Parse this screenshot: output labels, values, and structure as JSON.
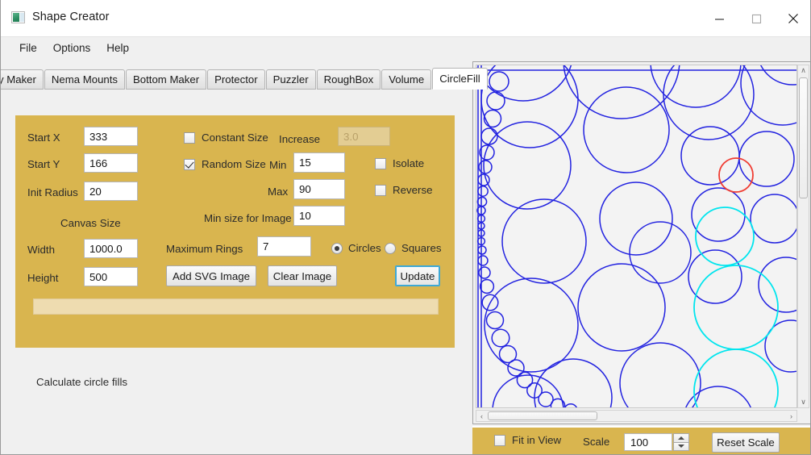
{
  "window": {
    "title": "Shape Creator",
    "icon": "app-icon",
    "minimize_label": "–",
    "maximize_label": "□",
    "close_label": "×"
  },
  "menubar": {
    "items": [
      {
        "label": "File"
      },
      {
        "label": "Options"
      },
      {
        "label": "Help"
      }
    ]
  },
  "tabs": {
    "items": [
      {
        "label": "y Maker",
        "active": false,
        "clipped": true
      },
      {
        "label": "Nema Mounts",
        "active": false
      },
      {
        "label": "Bottom Maker",
        "active": false
      },
      {
        "label": "Protector",
        "active": false
      },
      {
        "label": "Puzzler",
        "active": false
      },
      {
        "label": "RoughBox",
        "active": false
      },
      {
        "label": "Volume",
        "active": false
      },
      {
        "label": "CircleFill",
        "active": true
      }
    ],
    "overflow_icon": "chevron-down-icon"
  },
  "form": {
    "start_x": {
      "label": "Start X",
      "value": "333"
    },
    "start_y": {
      "label": "Start Y",
      "value": "166"
    },
    "init_radius": {
      "label": "Init Radius",
      "value": "20"
    },
    "canvas_size_label": "Canvas Size",
    "width": {
      "label": "Width",
      "value": "1000.0"
    },
    "height": {
      "label": "Height",
      "value": "500"
    },
    "constant_size": {
      "label": "Constant Size",
      "checked": false
    },
    "random_size": {
      "label": "Random Size",
      "checked": true
    },
    "increase": {
      "label": "Increase",
      "value": "3.0",
      "disabled": true
    },
    "min": {
      "label": "Min",
      "value": "15"
    },
    "max": {
      "label": "Max",
      "value": "90"
    },
    "min_size_for_image": {
      "label": "Min size for Image",
      "value": "10"
    },
    "isolate": {
      "label": "Isolate",
      "checked": false
    },
    "reverse": {
      "label": "Reverse",
      "checked": false
    },
    "maximum_rings": {
      "label": "Maximum Rings",
      "value": "7"
    },
    "shape_circles": {
      "label": "Circles",
      "selected": true
    },
    "shape_squares": {
      "label": "Squares",
      "selected": false
    },
    "add_svg_image": {
      "label": "Add SVG Image"
    },
    "clear_image": {
      "label": "Clear Image"
    },
    "update": {
      "label": "Update",
      "focused": true
    },
    "progress_value": 0
  },
  "status": {
    "text": "Calculate circle fills"
  },
  "bottombar": {
    "fit_in_view": {
      "label": "Fit in View",
      "checked": false
    },
    "scale_label": "Scale",
    "scale_value": "100",
    "reset_scale": {
      "label": "Reset Scale"
    }
  },
  "colors": {
    "panel_gold": "#d9b54f",
    "circle_blue": "#2222e0",
    "circle_red": "#f03c32",
    "circle_cyan": "#00e5ee",
    "focus_blue": "#3da8d6"
  },
  "canvas": {
    "scrollbars": {
      "vertical_up": "∧",
      "vertical_down": "∨",
      "horizontal_left": "‹",
      "horizontal_right": "›"
    }
  }
}
